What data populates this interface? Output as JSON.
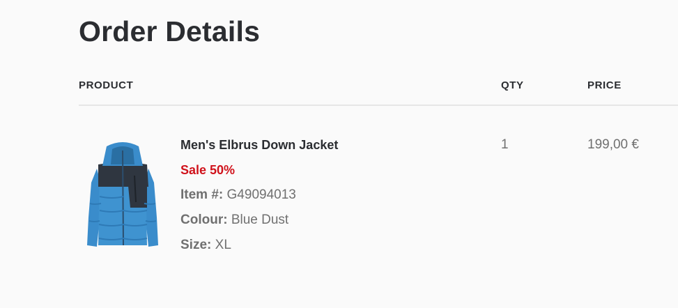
{
  "page": {
    "title": "Order Details"
  },
  "table": {
    "headers": {
      "product": "PRODUCT",
      "qty": "QTY",
      "price": "PRICE"
    },
    "items": [
      {
        "name": "Men's Elbrus Down Jacket",
        "sale": "Sale 50%",
        "item_label": "Item #:",
        "item_number": "G49094013",
        "colour_label": "Colour:",
        "colour": "Blue Dust",
        "size_label": "Size:",
        "size": "XL",
        "qty": "1",
        "price": "199,00 €",
        "image_icon": "blue-down-jacket-image"
      }
    ]
  },
  "colors": {
    "sale": "#d0121b",
    "text_dark": "#2b2d31",
    "text_muted": "#707070",
    "jacket_blue": "#3d8fcc",
    "jacket_dark": "#2f3640"
  }
}
